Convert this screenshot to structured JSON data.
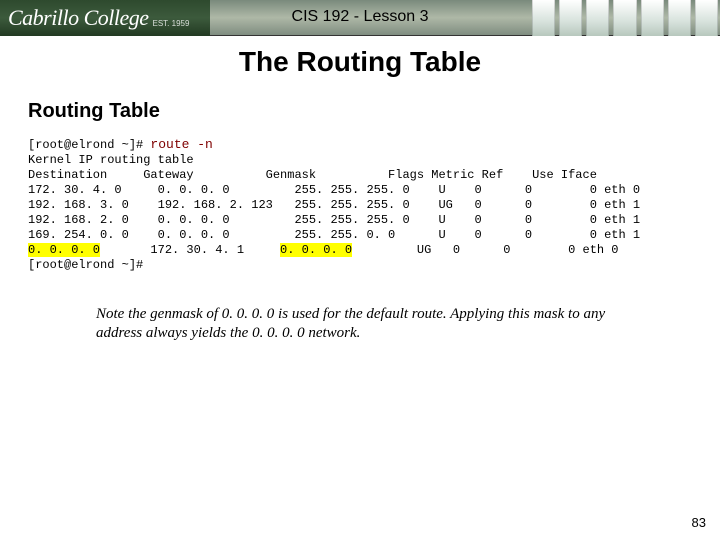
{
  "banner": {
    "logo_text": "Cabrillo College",
    "est": "EST. 1959",
    "course_title": "CIS 192 - Lesson 3"
  },
  "slide_title": "The Routing Table",
  "section_title": "Routing Table",
  "terminal": {
    "prompt1": "[root@elrond ~]# ",
    "command": "route -n",
    "header_line": "Kernel IP routing table",
    "columns_line": "Destination     Gateway          Genmask          Flags Metric Ref    Use Iface",
    "rows": [
      "172. 30. 4. 0     0. 0. 0. 0         255. 255. 255. 0    U    0      0        0 eth 0",
      "192. 168. 3. 0    192. 168. 2. 123   255. 255. 255. 0    UG   0      0        0 eth 1",
      "192. 168. 2. 0    0. 0. 0. 0         255. 255. 255. 0    U    0      0        0 eth 1",
      "169. 254. 0. 0    0. 0. 0. 0         255. 255. 0. 0      U    0      0        0 eth 1"
    ],
    "last_row_dest": "0. 0. 0. 0",
    "last_row_mid1": "       172. 30. 4. 1     ",
    "last_row_genmask": "0. 0. 0. 0",
    "last_row_mid2": "         UG   0      0        0 eth 0",
    "prompt2": "[root@elrond ~]#"
  },
  "note": "Note the genmask of 0. 0. 0. 0 is used for the default route. Applying this mask to any address always yields the 0. 0. 0. 0 network.",
  "page_number": "83"
}
